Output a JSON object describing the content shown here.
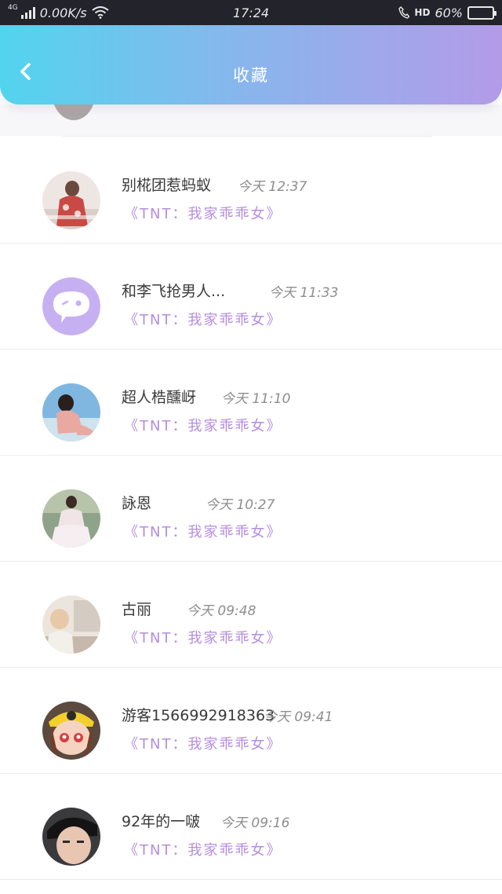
{
  "status_bar": {
    "network": "4G",
    "speed": "0.00K/s",
    "time": "17:24",
    "hd": "HD",
    "battery": "60%",
    "battery_level": 0.6
  },
  "header": {
    "title": "收藏",
    "back_icon": "chevron-left-icon",
    "gradient": [
      "#52d4ee",
      "#b39be8"
    ]
  },
  "favorites": [
    {
      "name": "别椛团惹蚂蚁",
      "time": "今天 12:37",
      "tag": "《TNT：我家乖乖女》"
    },
    {
      "name": "和李飞抢男人...",
      "time": "今天 11:33",
      "tag": "《TNT：我家乖乖女》"
    },
    {
      "name": "超人梏醺岈",
      "time": "今天 11:10",
      "tag": "《TNT：我家乖乖女》"
    },
    {
      "name": "詠恩",
      "time": "今天 10:27",
      "tag": "《TNT：我家乖乖女》"
    },
    {
      "name": "古丽",
      "time": "今天 09:48",
      "tag": "《TNT：我家乖乖女》"
    },
    {
      "name": "游客1566992918363",
      "time": "今天 09:41",
      "tag": "《TNT：我家乖乖女》"
    },
    {
      "name": "92年的一啵",
      "time": "今天 09:16",
      "tag": "《TNT：我家乖乖女》"
    }
  ],
  "colors": {
    "tag": "#b58de0",
    "default_avatar": "#c7b0f2"
  }
}
